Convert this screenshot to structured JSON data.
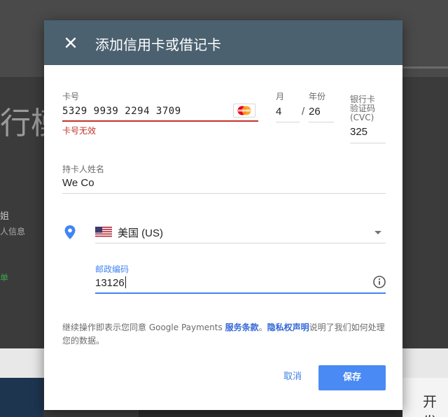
{
  "background": {
    "heading_fragment": "行模",
    "side_char": "姐",
    "side_sub": "人信息",
    "side_green": "单",
    "corner_text": "开发"
  },
  "dialog": {
    "title": "添加信用卡或借记卡",
    "card_number": {
      "label": "卡号",
      "value": "5329 9939 2294 3709",
      "error": "卡号无效",
      "brand_icon": "mastercard-icon"
    },
    "expiry": {
      "month_label": "月",
      "month_value": "4",
      "separator": "/",
      "year_label": "年份",
      "year_value": "26"
    },
    "cvc": {
      "label_lines": [
        "银行卡",
        "验证码",
        "(CVC)"
      ],
      "value": "325"
    },
    "cardholder": {
      "label": "持卡人姓名",
      "value": "We Co"
    },
    "country": {
      "flag_icon": "us-flag-icon",
      "value": "美国 (US)"
    },
    "postal_code": {
      "label": "邮政编码",
      "value": "13126",
      "icon": "info-icon"
    },
    "terms": {
      "prefix": "继续操作即表示您同意 Google Payments ",
      "link1": "服务条款",
      "mid": "。",
      "link2": "隐私权声明",
      "suffix": "说明了我们如何处理您的数据。"
    },
    "cancel_label": "取消",
    "save_label": "保存"
  },
  "colors": {
    "header": "#4b6170",
    "error": "#c5322a",
    "accent": "#4285f4",
    "save_button": "#4a8af4"
  }
}
